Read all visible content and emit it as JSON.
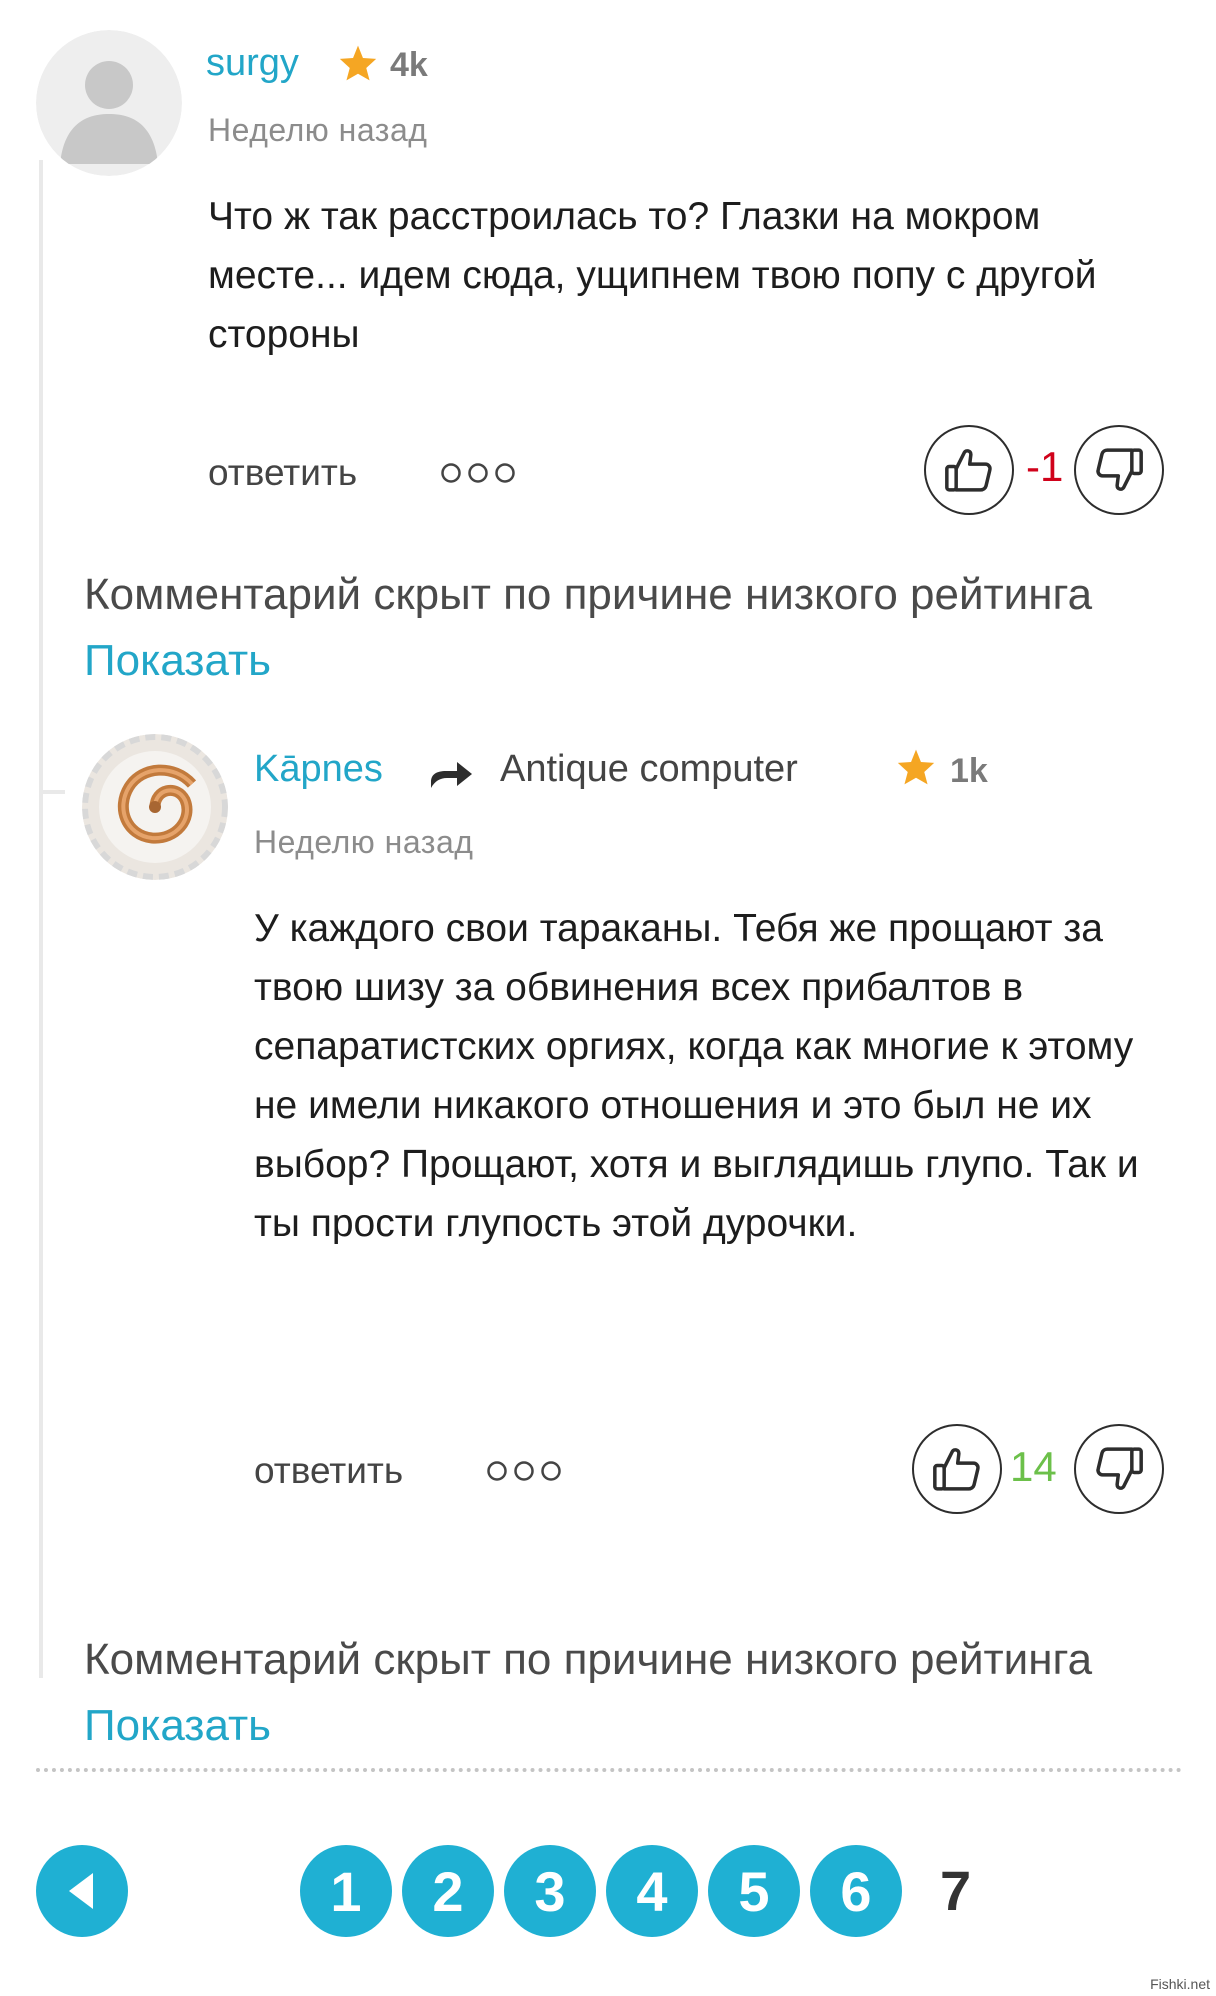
{
  "comments": [
    {
      "username": "surgy",
      "rating": "4k",
      "time": "Неделю назад",
      "text": "Что ж так расстроилась то? Глазки на мокром месте... идем сюда, ущипнем твою попу с другой стороны",
      "reply_label": "ответить",
      "more_icon": "ooo",
      "score": "-1",
      "score_color": "#d0021b"
    },
    {
      "username": "Kāpnes",
      "reply_to": "Antique computer",
      "rating": "1k",
      "time": "Неделю назад",
      "text": "У каждого свои тараканы. Тебя же прощают за твою шизу за обвинения всех прибалтов в сепаратистских оргиях, когда как многие к этому не имели никакого отношения и это был не их выбор? Прощают, хотя и выглядишь глупо. Так и ты прости глупость этой дурочки.",
      "reply_label": "ответить",
      "more_icon": "ooo",
      "score": "14",
      "score_color": "#6cc04a"
    }
  ],
  "hidden_notice": {
    "text": "Комментарий скрыт по причине низкого рейтинга",
    "link": "Показать"
  },
  "pagination": {
    "prev_icon": "arrow-left-icon",
    "pages": [
      "1",
      "2",
      "3",
      "4",
      "5",
      "6"
    ],
    "current": "7"
  },
  "watermark": "Fishki.net",
  "colors": {
    "accent": "#22a6c8",
    "pager": "#1fb0d3",
    "star": "#f5a623"
  }
}
